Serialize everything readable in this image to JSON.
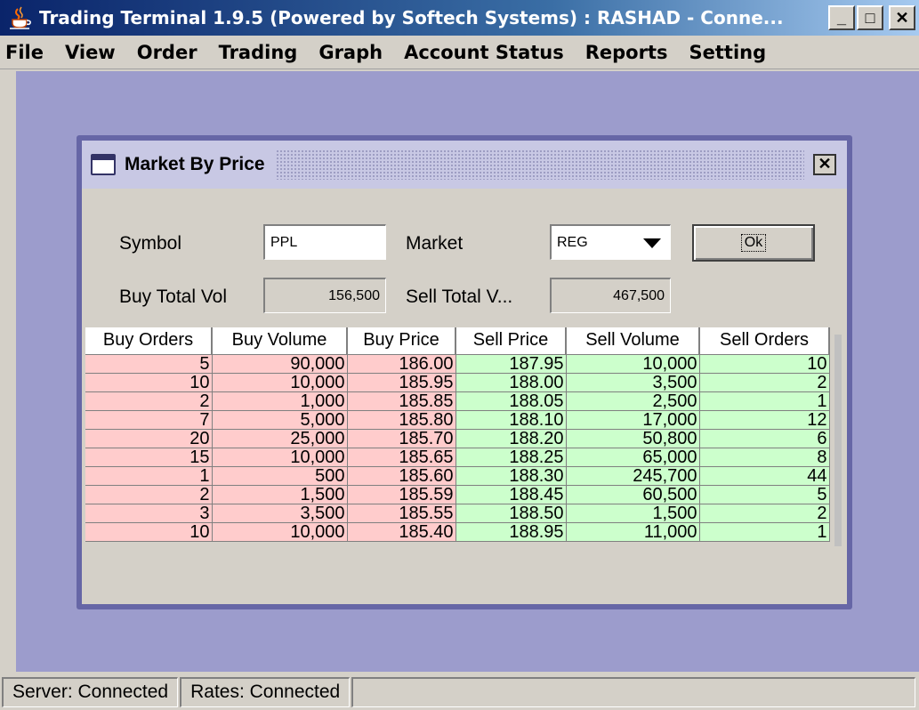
{
  "window": {
    "title": "Trading Terminal 1.9.5 (Powered by Softech Systems)   :   RASHAD - Conne...",
    "min_label": "_",
    "max_label": "□",
    "close_label": "✕"
  },
  "menu": {
    "items": [
      "File",
      "View",
      "Order",
      "Trading",
      "Graph",
      "Account Status",
      "Reports",
      "Setting"
    ]
  },
  "dialog": {
    "title": "Market By Price",
    "close_label": "✕",
    "symbol_label": "Symbol",
    "symbol_value": "PPL",
    "market_label": "Market",
    "market_value": "REG",
    "ok_label": "Ok",
    "buy_total_label": "Buy Total Vol",
    "buy_total_value": "156,500",
    "sell_total_label": "Sell Total V...",
    "sell_total_value": "467,500"
  },
  "table": {
    "headers": [
      "Buy Orders",
      "Buy Volume",
      "Buy Price",
      "Sell Price",
      "Sell Volume",
      "Sell Orders"
    ],
    "rows": [
      [
        "5",
        "90,000",
        "186.00",
        "187.95",
        "10,000",
        "10"
      ],
      [
        "10",
        "10,000",
        "185.95",
        "188.00",
        "3,500",
        "2"
      ],
      [
        "2",
        "1,000",
        "185.85",
        "188.05",
        "2,500",
        "1"
      ],
      [
        "7",
        "5,000",
        "185.80",
        "188.10",
        "17,000",
        "12"
      ],
      [
        "20",
        "25,000",
        "185.70",
        "188.20",
        "50,800",
        "6"
      ],
      [
        "15",
        "10,000",
        "185.65",
        "188.25",
        "65,000",
        "8"
      ],
      [
        "1",
        "500",
        "185.60",
        "188.30",
        "245,700",
        "44"
      ],
      [
        "2",
        "1,500",
        "185.59",
        "188.45",
        "60,500",
        "5"
      ],
      [
        "3",
        "3,500",
        "185.55",
        "188.50",
        "1,500",
        "2"
      ],
      [
        "10",
        "10,000",
        "185.40",
        "188.95",
        "11,000",
        "1"
      ]
    ]
  },
  "status": {
    "server": "Server: Connected",
    "rates": "Rates: Connected",
    "extra": ""
  },
  "colors": {
    "buy_row": "#ffcccc",
    "sell_row": "#ccffcc",
    "desktop": "#9c9ccc",
    "title_gradient_start": "#0a246a"
  },
  "icons": {
    "app": "java-cup-icon",
    "dialog": "window-frame-icon",
    "combo": "triangle-down-icon"
  }
}
